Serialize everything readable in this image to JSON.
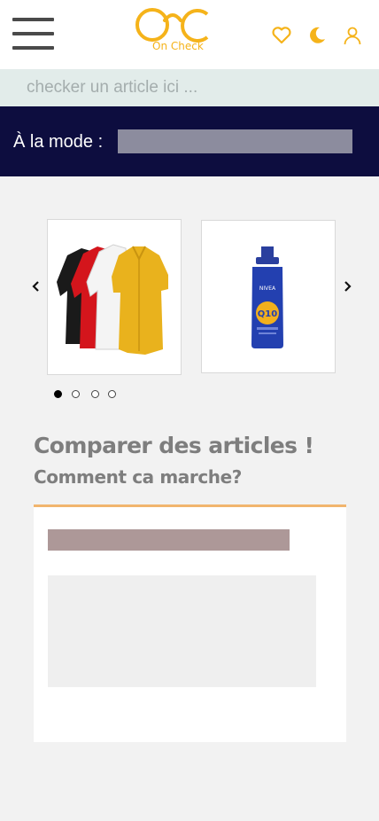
{
  "header": {
    "logo_text": "On Check",
    "menu_icon": "hamburger-menu-icon",
    "icons": [
      "heart-icon",
      "moon-icon",
      "user-icon"
    ],
    "accent_color": "#f5b31a"
  },
  "search": {
    "placeholder": "checker un article ici ..."
  },
  "banner": {
    "label": "À la mode :"
  },
  "carousel": {
    "items": [
      "shirts-product-image",
      "lotion-product-image"
    ],
    "dots": 4,
    "active_dot": 1
  },
  "main": {
    "title": "Comparer des articles !",
    "subtitle": "Comment ca marche?"
  }
}
